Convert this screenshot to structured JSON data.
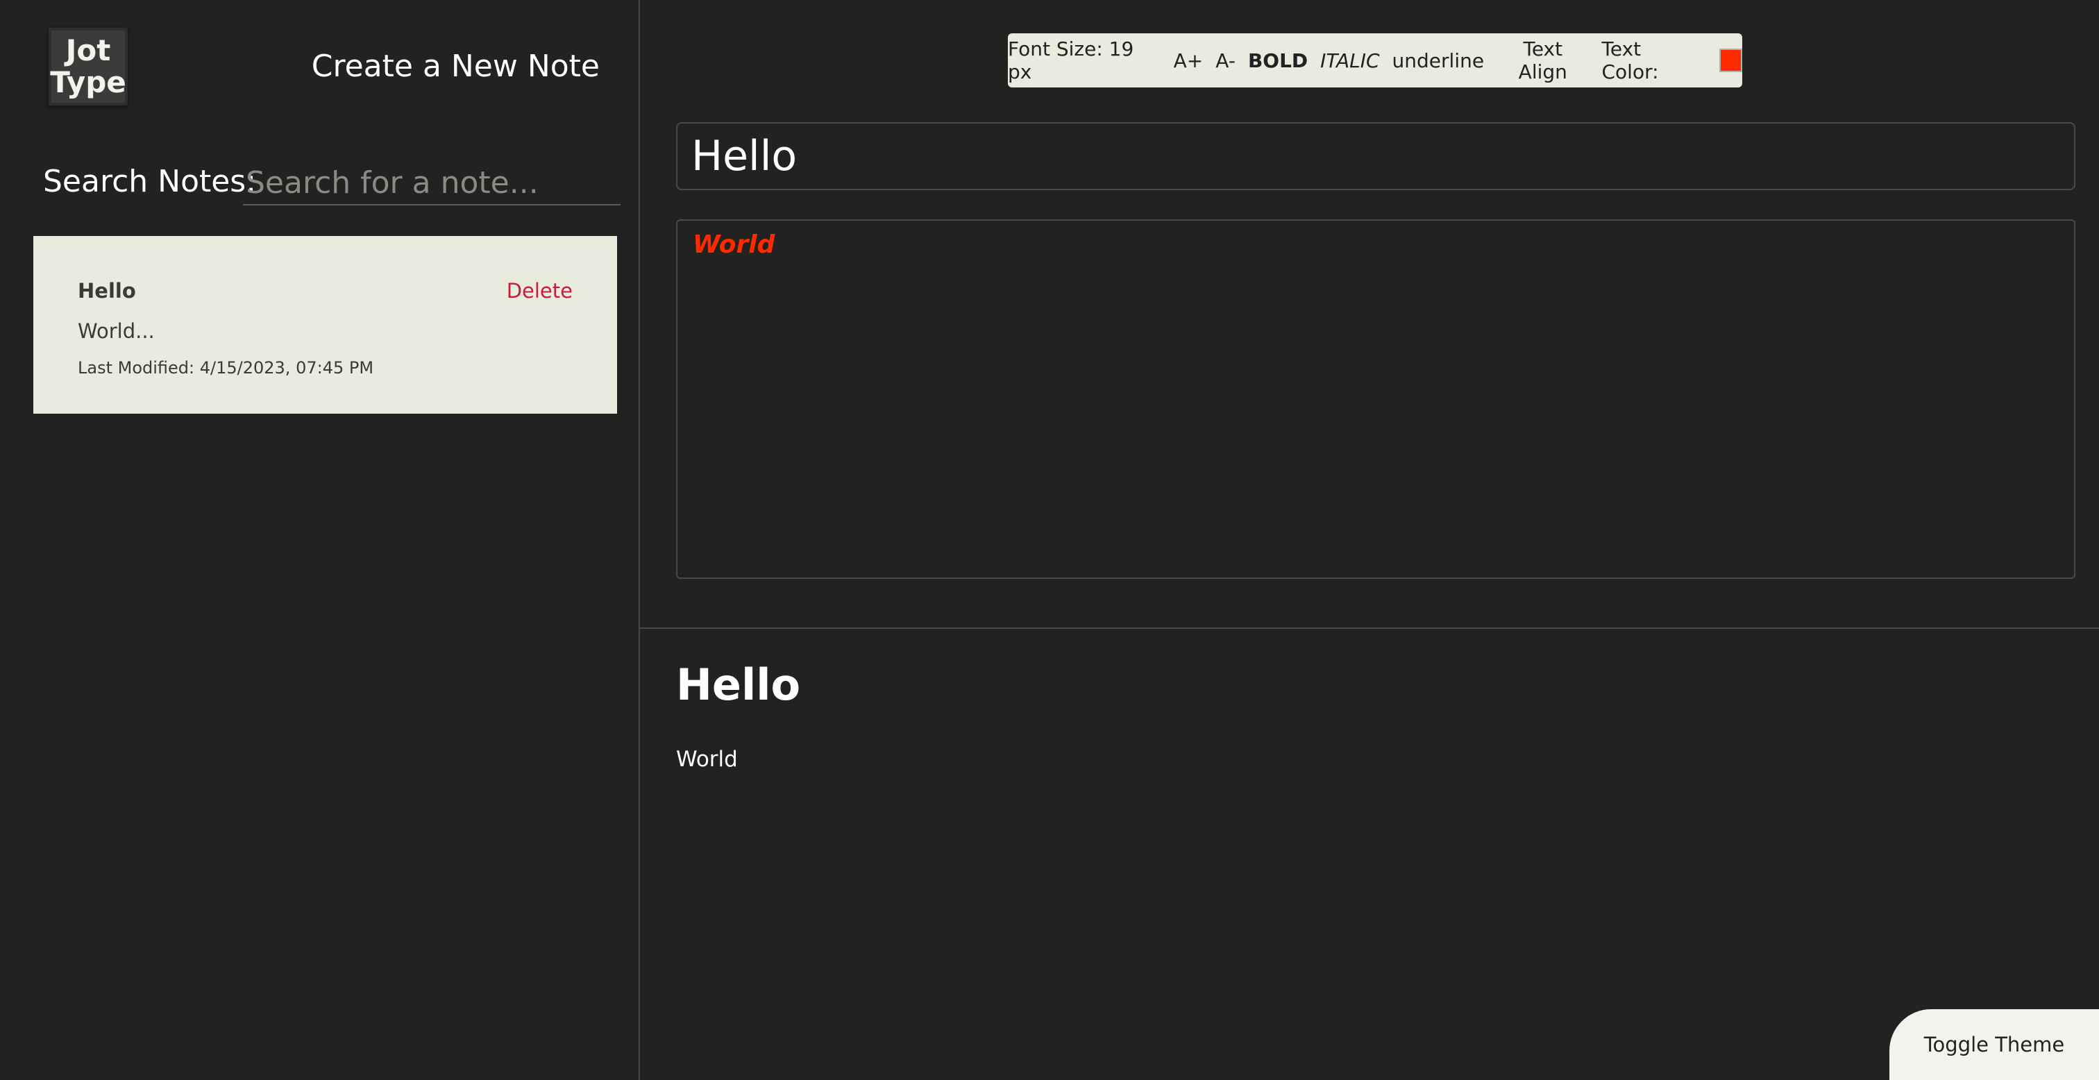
{
  "app": {
    "logo_line1": "Jot",
    "logo_line2": "Type"
  },
  "sidebar": {
    "create_note_label": "Create a New Note",
    "search_label": "Search Notes:",
    "search_placeholder": "Search for a note...",
    "search_value": "",
    "notes": [
      {
        "title": "Hello",
        "delete_label": "Delete",
        "preview": "World...",
        "last_modified": "Last Modified: 4/15/2023, 07:45 PM"
      }
    ]
  },
  "toolbar": {
    "font_size_label": "Font Size: 19 px",
    "increase_label": "A+",
    "decrease_label": "A-",
    "bold_label": "BOLD",
    "italic_label": "ITALIC",
    "underline_label": "underline",
    "text_align_label": "Text Align",
    "text_color_label": "Text Color:",
    "text_color_value": "#ff2a00"
  },
  "editor": {
    "title_value": "Hello",
    "body_value": "World"
  },
  "preview": {
    "title": "Hello",
    "body": "World"
  },
  "footer": {
    "toggle_theme_label": "Toggle Theme"
  },
  "colors": {
    "background": "#222220",
    "card": "#e8ecdf",
    "delete": "#cc1a3a",
    "accent_text": "#ff2a00"
  }
}
